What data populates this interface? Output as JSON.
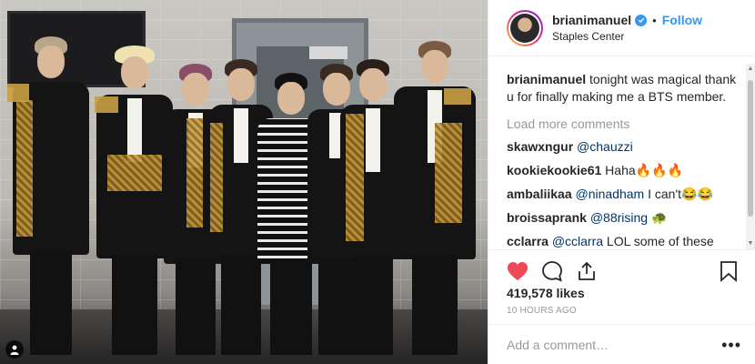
{
  "post": {
    "username": "brianimanuel",
    "verified": true,
    "separator": "•",
    "follow_label": "Follow",
    "location": "Staples Center",
    "caption_text": "tonight was magical thank u for finally making me a BTS member.",
    "load_more_label": "Load more comments",
    "comments": [
      {
        "user": "skawxngur",
        "mention": "@chauzzi",
        "text": ""
      },
      {
        "user": "kookiekookie61",
        "mention": "",
        "text": "Haha🔥🔥🔥"
      },
      {
        "user": "ambaliikaa",
        "mention": "@ninadham",
        "text": " I can't😂😂"
      },
      {
        "user": "broissaprank",
        "mention": "@88rising",
        "text": " 🐢"
      },
      {
        "user": "cclarra",
        "mention": "@cclarra",
        "text": " LOL some of these comments actually believed his caption i'm- :\")"
      }
    ],
    "likes": "419,578 likes",
    "timestamp": "10 HOURS AGO",
    "add_comment_placeholder": "Add a comment…",
    "more_options": "•••"
  },
  "colors": {
    "accent": "#3897f0",
    "like": "#ed4956",
    "text": "#262626",
    "muted": "#999999"
  },
  "icons": {
    "heart": "heart-icon",
    "comment": "comment-icon",
    "share": "share-icon",
    "bookmark": "bookmark-icon",
    "verified": "verified-badge-icon",
    "user_tag": "user-tag-icon"
  }
}
